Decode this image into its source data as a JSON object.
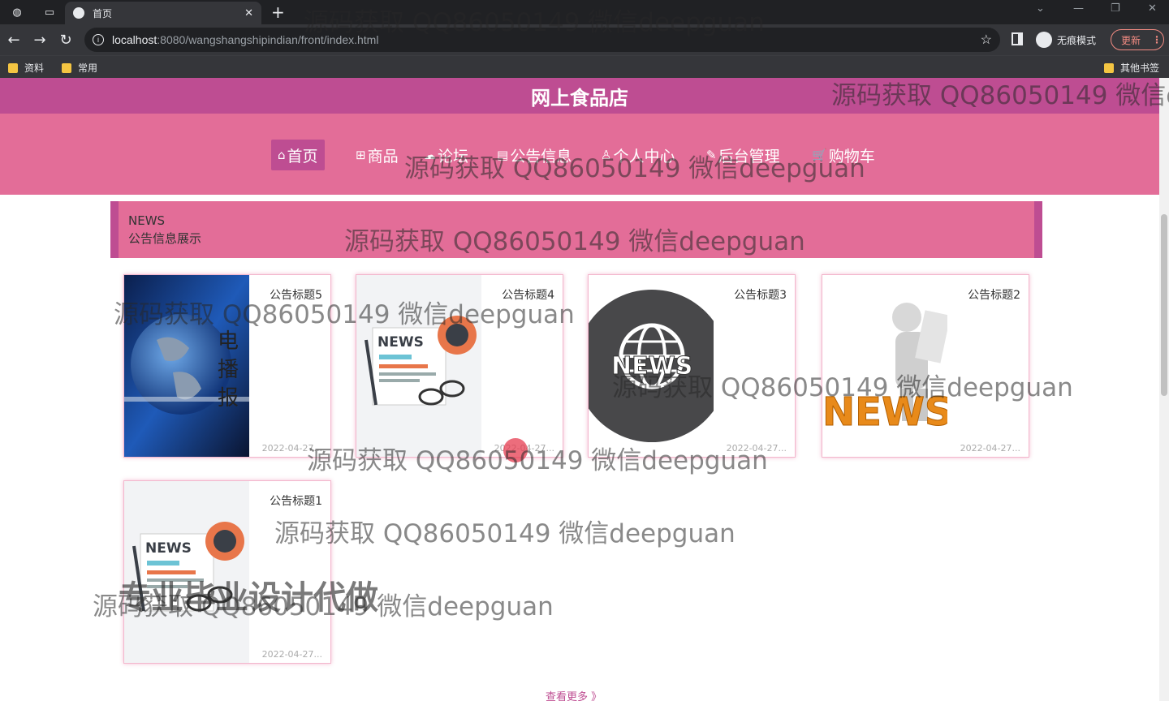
{
  "browser": {
    "tab_title": "首页",
    "url_host": "localhost",
    "url_path": ":8080/wangshangshipindian/front/index.html",
    "incognito_label": "无痕模式",
    "update_label": "更新",
    "bookmarks": [
      "资料",
      "常用"
    ],
    "other_bookmarks": "其他书签"
  },
  "site": {
    "title": "网上食品店",
    "nav": [
      {
        "label": "首页",
        "icon": "home-icon"
      },
      {
        "label": "商品",
        "icon": "gift-icon"
      },
      {
        "label": "论坛",
        "icon": "forum-icon"
      },
      {
        "label": "公告信息",
        "icon": "notice-icon"
      },
      {
        "label": "个人中心",
        "icon": "user-icon"
      },
      {
        "label": "后台管理",
        "icon": "settings-icon"
      },
      {
        "label": "购物车",
        "icon": "cart-icon"
      }
    ]
  },
  "news": {
    "heading_en": "NEWS",
    "heading_cn": "公告信息展示",
    "items": [
      {
        "title": "公告标题5",
        "date": "2022-04-27..."
      },
      {
        "title": "公告标题4",
        "date": "2022-04-27..."
      },
      {
        "title": "公告标题3",
        "date": "2022-04-27..."
      },
      {
        "title": "公告标题2",
        "date": "2022-04-27..."
      },
      {
        "title": "公告标题1",
        "date": "2022-04-27..."
      }
    ],
    "more_label": "查看更多 》"
  },
  "watermark": {
    "text": "源码获取 QQ86050149 微信deepguan",
    "big_text": "专业毕业设计代做"
  }
}
